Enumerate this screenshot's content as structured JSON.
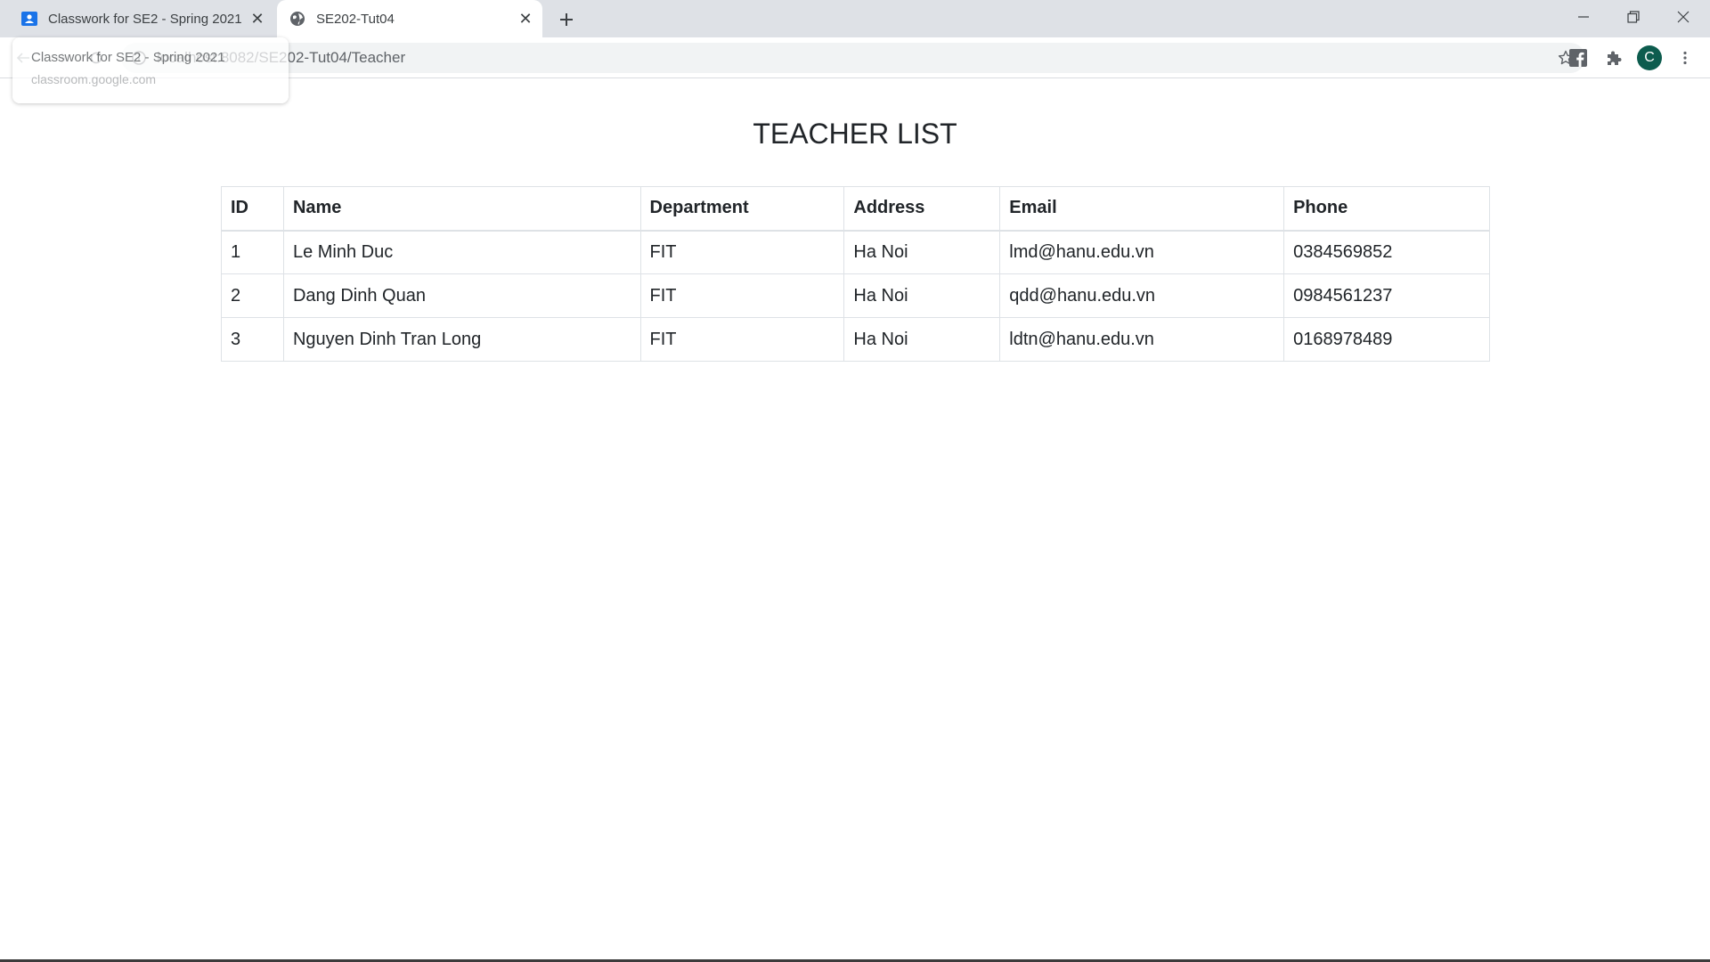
{
  "browser": {
    "tabs": [
      {
        "title": "Classwork for SE2 - Spring 2021",
        "favicon": "google-classroom-icon",
        "active": false
      },
      {
        "title": "SE202-Tut04",
        "favicon": "globe-icon",
        "active": true
      }
    ],
    "url": "localhost:8082/SE202-Tut04/Teacher",
    "profile_initial": "C",
    "hovercard": {
      "title": "Classwork for SE2 - Spring 2021",
      "domain": "classroom.google.com"
    }
  },
  "page": {
    "title": "TEACHER LIST",
    "table": {
      "headers": [
        "ID",
        "Name",
        "Department",
        "Address",
        "Email",
        "Phone"
      ],
      "rows": [
        [
          "1",
          "Le Minh Duc",
          "FIT",
          "Ha Noi",
          "lmd@hanu.edu.vn",
          "0384569852"
        ],
        [
          "2",
          "Dang Dinh Quan",
          "FIT",
          "Ha Noi",
          "qdd@hanu.edu.vn",
          "0984561237"
        ],
        [
          "3",
          "Nguyen Dinh Tran Long",
          "FIT",
          "Ha Noi",
          "ldtn@hanu.edu.vn",
          "0168978489"
        ]
      ]
    }
  }
}
